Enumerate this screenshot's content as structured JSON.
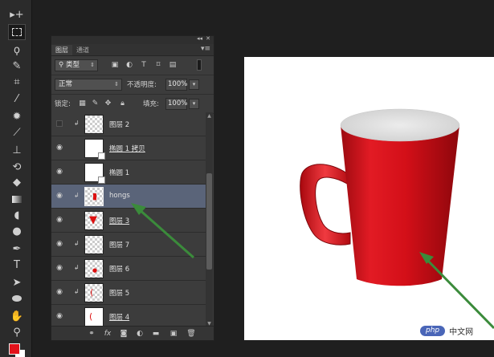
{
  "colors": {
    "foreground_swatch": "#e2121b",
    "background_swatch": "#ffffff",
    "selected_layer": "#5a6479",
    "arrow": "#3b8b3b",
    "cup_red": "#d50f18"
  },
  "toolbar": {
    "tools": [
      "move-tool-icon",
      "marquee-tool-icon",
      "lasso-tool-icon",
      "quick-select-icon",
      "crop-tool-icon",
      "eyedropper-icon",
      "healing-brush-icon",
      "brush-tool-icon",
      "clone-stamp-icon",
      "history-brush-icon",
      "eraser-icon",
      "gradient-tool-icon",
      "blur-tool-icon",
      "dodge-tool-icon",
      "pen-tool-icon",
      "type-tool-icon",
      "path-select-icon",
      "ellipse-tool-icon",
      "hand-tool-icon",
      "zoom-tool-icon"
    ]
  },
  "panel": {
    "tabs": [
      "图层",
      "通道"
    ],
    "filter_label": "类型",
    "blend_mode": "正常",
    "opacity_label": "不透明度:",
    "opacity_value": "100%",
    "lock_label": "锁定:",
    "fill_label": "填充:",
    "fill_value": "100%",
    "layers": [
      {
        "name": "图层 2",
        "visible": false,
        "clipped": true,
        "underline": false
      },
      {
        "name": "椭圆 1 拷贝",
        "visible": true,
        "clipped": false,
        "underline": true
      },
      {
        "name": "椭圆 1",
        "visible": true,
        "clipped": false,
        "underline": false
      },
      {
        "name": "hongs",
        "visible": true,
        "clipped": true,
        "underline": false,
        "selected": true
      },
      {
        "name": "图层 3",
        "visible": true,
        "clipped": false,
        "underline": true
      },
      {
        "name": "图层 7",
        "visible": true,
        "clipped": true,
        "underline": false
      },
      {
        "name": "图层 6",
        "visible": true,
        "clipped": true,
        "underline": false
      },
      {
        "name": "图层 5",
        "visible": true,
        "clipped": true,
        "underline": false
      },
      {
        "name": "图层 4",
        "visible": true,
        "clipped": false,
        "underline": true
      }
    ],
    "bottom_icons": [
      "link-layers-icon",
      "fx-icon",
      "add-mask-icon",
      "adjustment-layer-icon",
      "new-group-icon",
      "new-layer-icon",
      "delete-layer-icon"
    ]
  },
  "watermark": {
    "badge": "php",
    "text": "中文网"
  }
}
